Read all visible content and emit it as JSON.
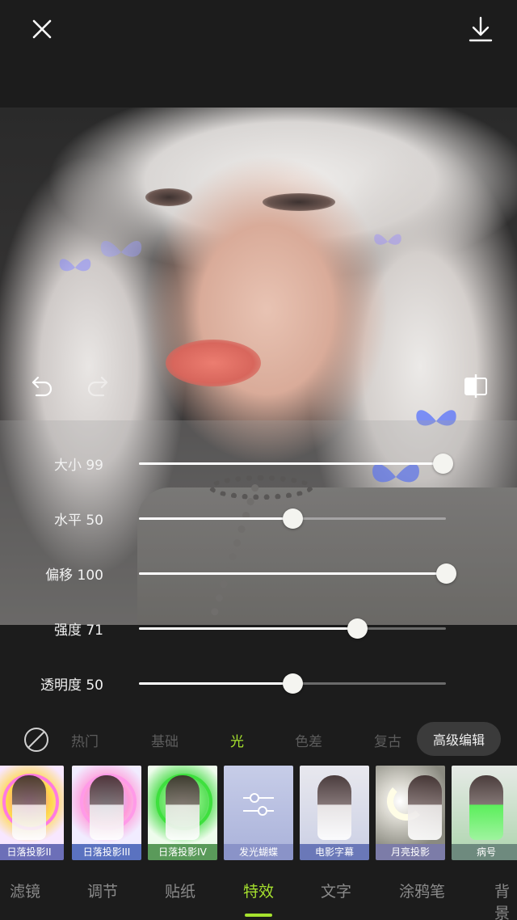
{
  "header": {
    "close_icon": "close-icon",
    "download_icon": "download-icon"
  },
  "canvas": {
    "undo_icon": "undo-icon",
    "redo_icon": "redo-icon",
    "compare_icon": "compare-icon"
  },
  "sliders": [
    {
      "label": "大小 99",
      "value": 99
    },
    {
      "label": "水平 50",
      "value": 50
    },
    {
      "label": "偏移 100",
      "value": 100
    },
    {
      "label": "强度 71",
      "value": 71
    },
    {
      "label": "透明度 50",
      "value": 50
    }
  ],
  "categories": {
    "none_icon": "none-icon",
    "tabs": [
      "热门",
      "基础",
      "光",
      "色差",
      "复古"
    ],
    "active": "光",
    "advanced_label": "高级编辑"
  },
  "effects": [
    {
      "label": "日落投影II",
      "caption_color": "#6c6fb8"
    },
    {
      "label": "日落投影III",
      "caption_color": "#5a72c0"
    },
    {
      "label": "日落投影IV",
      "caption_color": "#5a9a5a"
    },
    {
      "label": "发光蝴蝶",
      "caption_color": "#8a93c8"
    },
    {
      "label": "电影字幕",
      "caption_color": "#6a78b8"
    },
    {
      "label": "月亮投影",
      "caption_color": "#7c7ca8"
    },
    {
      "label": "病号",
      "caption_color": "#6e8a7e"
    }
  ],
  "bottom_nav": {
    "tabs": [
      "滤镜",
      "调节",
      "贴纸",
      "特效",
      "文字",
      "涂鸦笔",
      "背景"
    ],
    "active": "特效"
  },
  "colors": {
    "accent": "#a6e22e",
    "background": "#1c1c1c"
  }
}
